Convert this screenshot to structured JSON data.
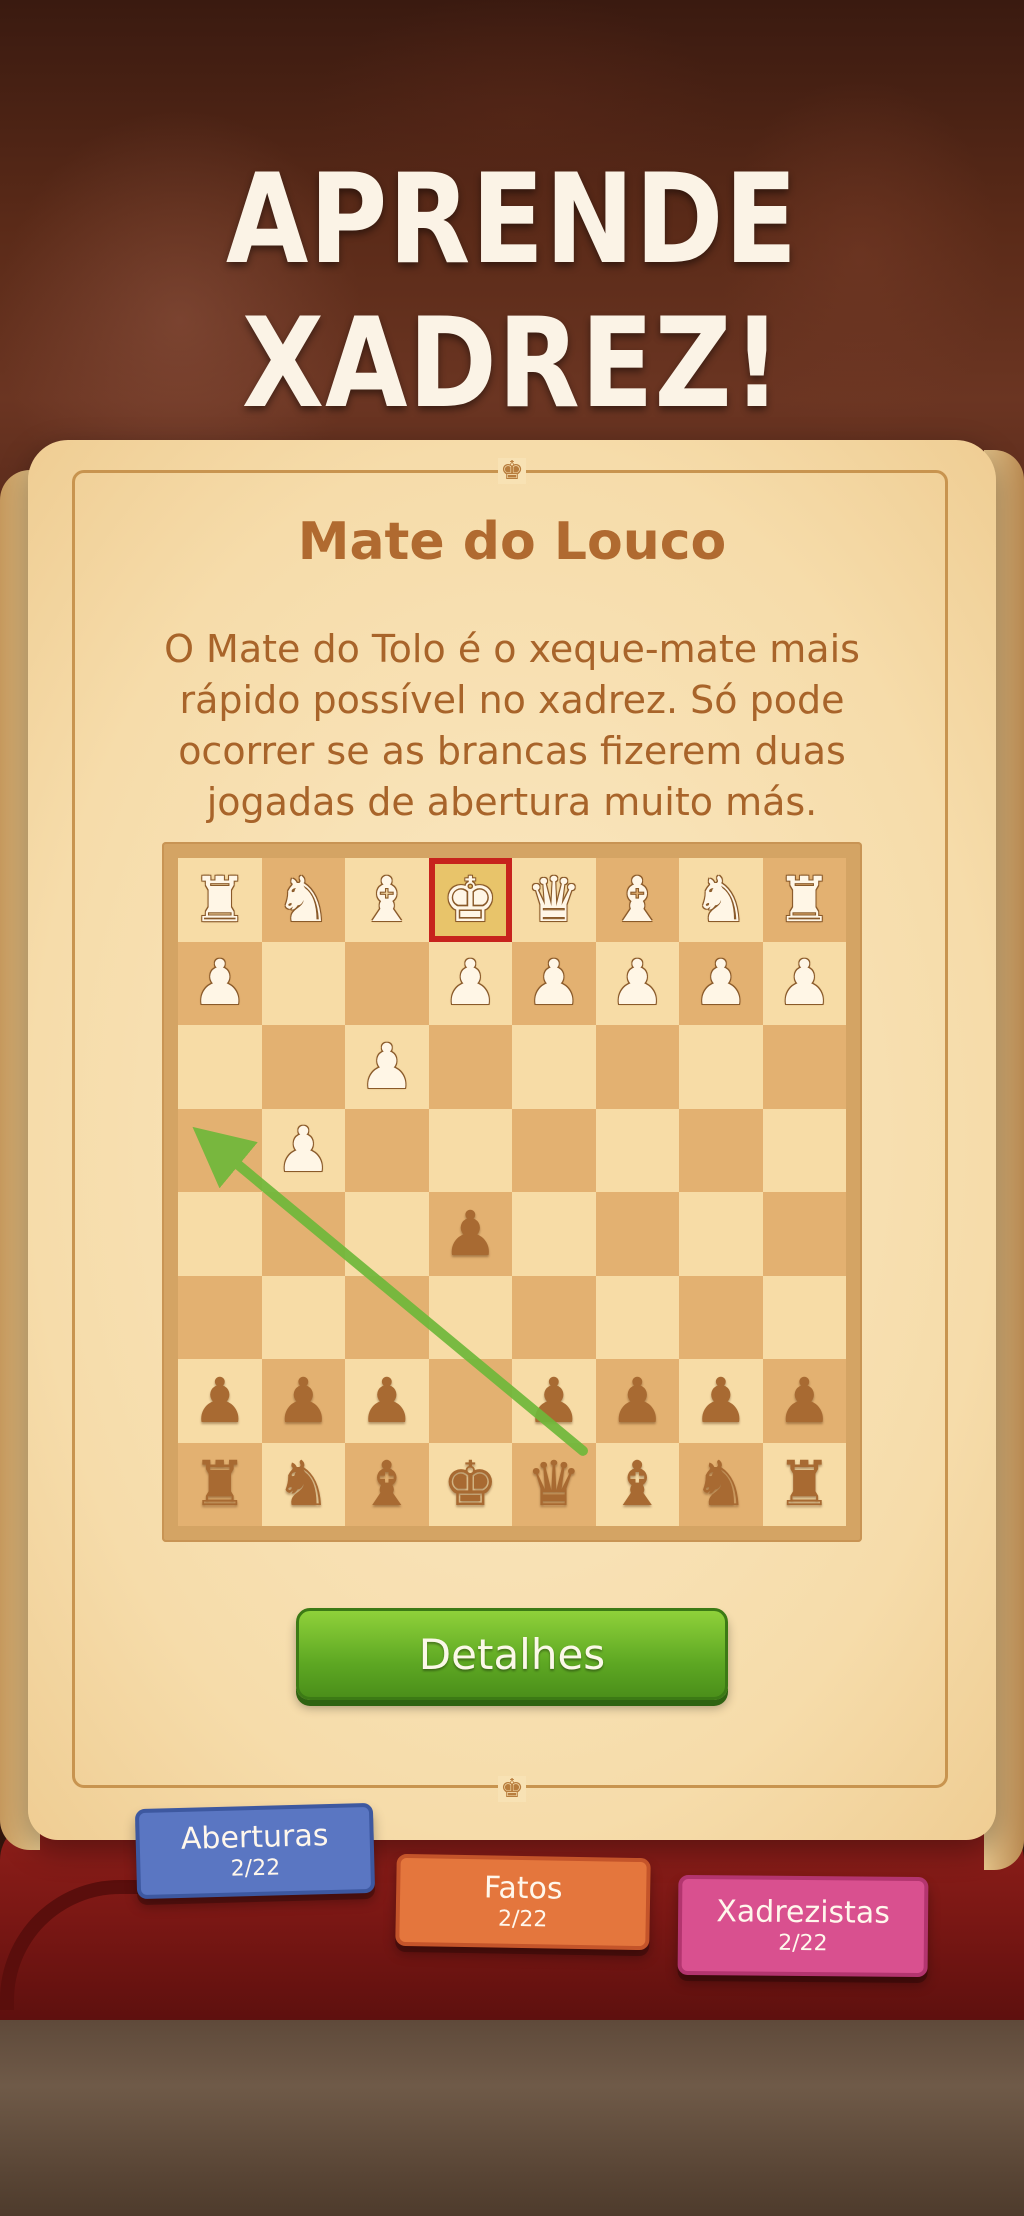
{
  "title": "APRENDE XADREZ!",
  "page": {
    "heading": "Mate do Louco",
    "description": "O Mate do Tolo é o xeque-mate mais rápido possível no xadrez. Só pode ocorrer se as brancas fizerem duas jogadas de abertura muito más."
  },
  "board": {
    "ranks": [
      [
        "wR",
        "wN",
        "wB",
        "wK",
        "wQ",
        "wB",
        "wN",
        "wR"
      ],
      [
        "wP",
        "",
        "",
        "wP",
        "wP",
        "wP",
        "wP",
        "wP"
      ],
      [
        "",
        "",
        "wP",
        "",
        "",
        "",
        "",
        ""
      ],
      [
        "",
        "wP",
        "",
        "",
        "",
        "",
        "",
        ""
      ],
      [
        "",
        "",
        "",
        "bP",
        "",
        "",
        "",
        ""
      ],
      [
        "",
        "",
        "",
        "",
        "",
        "",
        "",
        ""
      ],
      [
        "bP",
        "bP",
        "bP",
        "",
        "bP",
        "bP",
        "bP",
        "bP"
      ],
      [
        "bR",
        "bN",
        "bB",
        "bK",
        "bQ",
        "bB",
        "bN",
        "bR"
      ]
    ],
    "check_square": "row0-col3",
    "move_arrow": {
      "from": "row7-col4",
      "to": "row3-col0",
      "color": "#6fb83a"
    }
  },
  "details_button": {
    "label": "Detalhes"
  },
  "tabs": [
    {
      "label": "Aberturas",
      "count": "2/22",
      "color": "#5a76c2"
    },
    {
      "label": "Fatos",
      "count": "2/22",
      "color": "#e4763d"
    },
    {
      "label": "Xadrezistas",
      "count": "2/22",
      "color": "#d9508f"
    }
  ],
  "icons": {
    "ornament": "crown-ornament-icon"
  }
}
